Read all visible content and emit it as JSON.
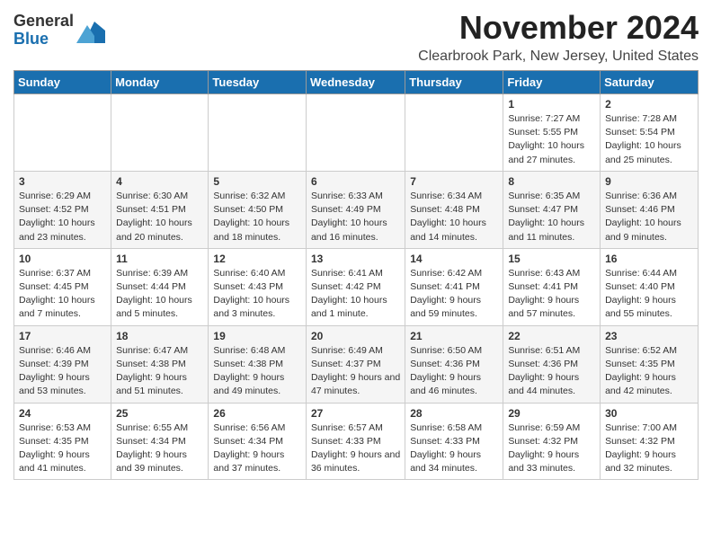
{
  "header": {
    "logo_line1": "General",
    "logo_line2": "Blue",
    "month": "November 2024",
    "location": "Clearbrook Park, New Jersey, United States"
  },
  "weekdays": [
    "Sunday",
    "Monday",
    "Tuesday",
    "Wednesday",
    "Thursday",
    "Friday",
    "Saturday"
  ],
  "weeks": [
    [
      {
        "day": "",
        "info": ""
      },
      {
        "day": "",
        "info": ""
      },
      {
        "day": "",
        "info": ""
      },
      {
        "day": "",
        "info": ""
      },
      {
        "day": "",
        "info": ""
      },
      {
        "day": "1",
        "info": "Sunrise: 7:27 AM\nSunset: 5:55 PM\nDaylight: 10 hours and 27 minutes."
      },
      {
        "day": "2",
        "info": "Sunrise: 7:28 AM\nSunset: 5:54 PM\nDaylight: 10 hours and 25 minutes."
      }
    ],
    [
      {
        "day": "3",
        "info": "Sunrise: 6:29 AM\nSunset: 4:52 PM\nDaylight: 10 hours and 23 minutes."
      },
      {
        "day": "4",
        "info": "Sunrise: 6:30 AM\nSunset: 4:51 PM\nDaylight: 10 hours and 20 minutes."
      },
      {
        "day": "5",
        "info": "Sunrise: 6:32 AM\nSunset: 4:50 PM\nDaylight: 10 hours and 18 minutes."
      },
      {
        "day": "6",
        "info": "Sunrise: 6:33 AM\nSunset: 4:49 PM\nDaylight: 10 hours and 16 minutes."
      },
      {
        "day": "7",
        "info": "Sunrise: 6:34 AM\nSunset: 4:48 PM\nDaylight: 10 hours and 14 minutes."
      },
      {
        "day": "8",
        "info": "Sunrise: 6:35 AM\nSunset: 4:47 PM\nDaylight: 10 hours and 11 minutes."
      },
      {
        "day": "9",
        "info": "Sunrise: 6:36 AM\nSunset: 4:46 PM\nDaylight: 10 hours and 9 minutes."
      }
    ],
    [
      {
        "day": "10",
        "info": "Sunrise: 6:37 AM\nSunset: 4:45 PM\nDaylight: 10 hours and 7 minutes."
      },
      {
        "day": "11",
        "info": "Sunrise: 6:39 AM\nSunset: 4:44 PM\nDaylight: 10 hours and 5 minutes."
      },
      {
        "day": "12",
        "info": "Sunrise: 6:40 AM\nSunset: 4:43 PM\nDaylight: 10 hours and 3 minutes."
      },
      {
        "day": "13",
        "info": "Sunrise: 6:41 AM\nSunset: 4:42 PM\nDaylight: 10 hours and 1 minute."
      },
      {
        "day": "14",
        "info": "Sunrise: 6:42 AM\nSunset: 4:41 PM\nDaylight: 9 hours and 59 minutes."
      },
      {
        "day": "15",
        "info": "Sunrise: 6:43 AM\nSunset: 4:41 PM\nDaylight: 9 hours and 57 minutes."
      },
      {
        "day": "16",
        "info": "Sunrise: 6:44 AM\nSunset: 4:40 PM\nDaylight: 9 hours and 55 minutes."
      }
    ],
    [
      {
        "day": "17",
        "info": "Sunrise: 6:46 AM\nSunset: 4:39 PM\nDaylight: 9 hours and 53 minutes."
      },
      {
        "day": "18",
        "info": "Sunrise: 6:47 AM\nSunset: 4:38 PM\nDaylight: 9 hours and 51 minutes."
      },
      {
        "day": "19",
        "info": "Sunrise: 6:48 AM\nSunset: 4:38 PM\nDaylight: 9 hours and 49 minutes."
      },
      {
        "day": "20",
        "info": "Sunrise: 6:49 AM\nSunset: 4:37 PM\nDaylight: 9 hours and 47 minutes."
      },
      {
        "day": "21",
        "info": "Sunrise: 6:50 AM\nSunset: 4:36 PM\nDaylight: 9 hours and 46 minutes."
      },
      {
        "day": "22",
        "info": "Sunrise: 6:51 AM\nSunset: 4:36 PM\nDaylight: 9 hours and 44 minutes."
      },
      {
        "day": "23",
        "info": "Sunrise: 6:52 AM\nSunset: 4:35 PM\nDaylight: 9 hours and 42 minutes."
      }
    ],
    [
      {
        "day": "24",
        "info": "Sunrise: 6:53 AM\nSunset: 4:35 PM\nDaylight: 9 hours and 41 minutes."
      },
      {
        "day": "25",
        "info": "Sunrise: 6:55 AM\nSunset: 4:34 PM\nDaylight: 9 hours and 39 minutes."
      },
      {
        "day": "26",
        "info": "Sunrise: 6:56 AM\nSunset: 4:34 PM\nDaylight: 9 hours and 37 minutes."
      },
      {
        "day": "27",
        "info": "Sunrise: 6:57 AM\nSunset: 4:33 PM\nDaylight: 9 hours and 36 minutes."
      },
      {
        "day": "28",
        "info": "Sunrise: 6:58 AM\nSunset: 4:33 PM\nDaylight: 9 hours and 34 minutes."
      },
      {
        "day": "29",
        "info": "Sunrise: 6:59 AM\nSunset: 4:32 PM\nDaylight: 9 hours and 33 minutes."
      },
      {
        "day": "30",
        "info": "Sunrise: 7:00 AM\nSunset: 4:32 PM\nDaylight: 9 hours and 32 minutes."
      }
    ]
  ]
}
